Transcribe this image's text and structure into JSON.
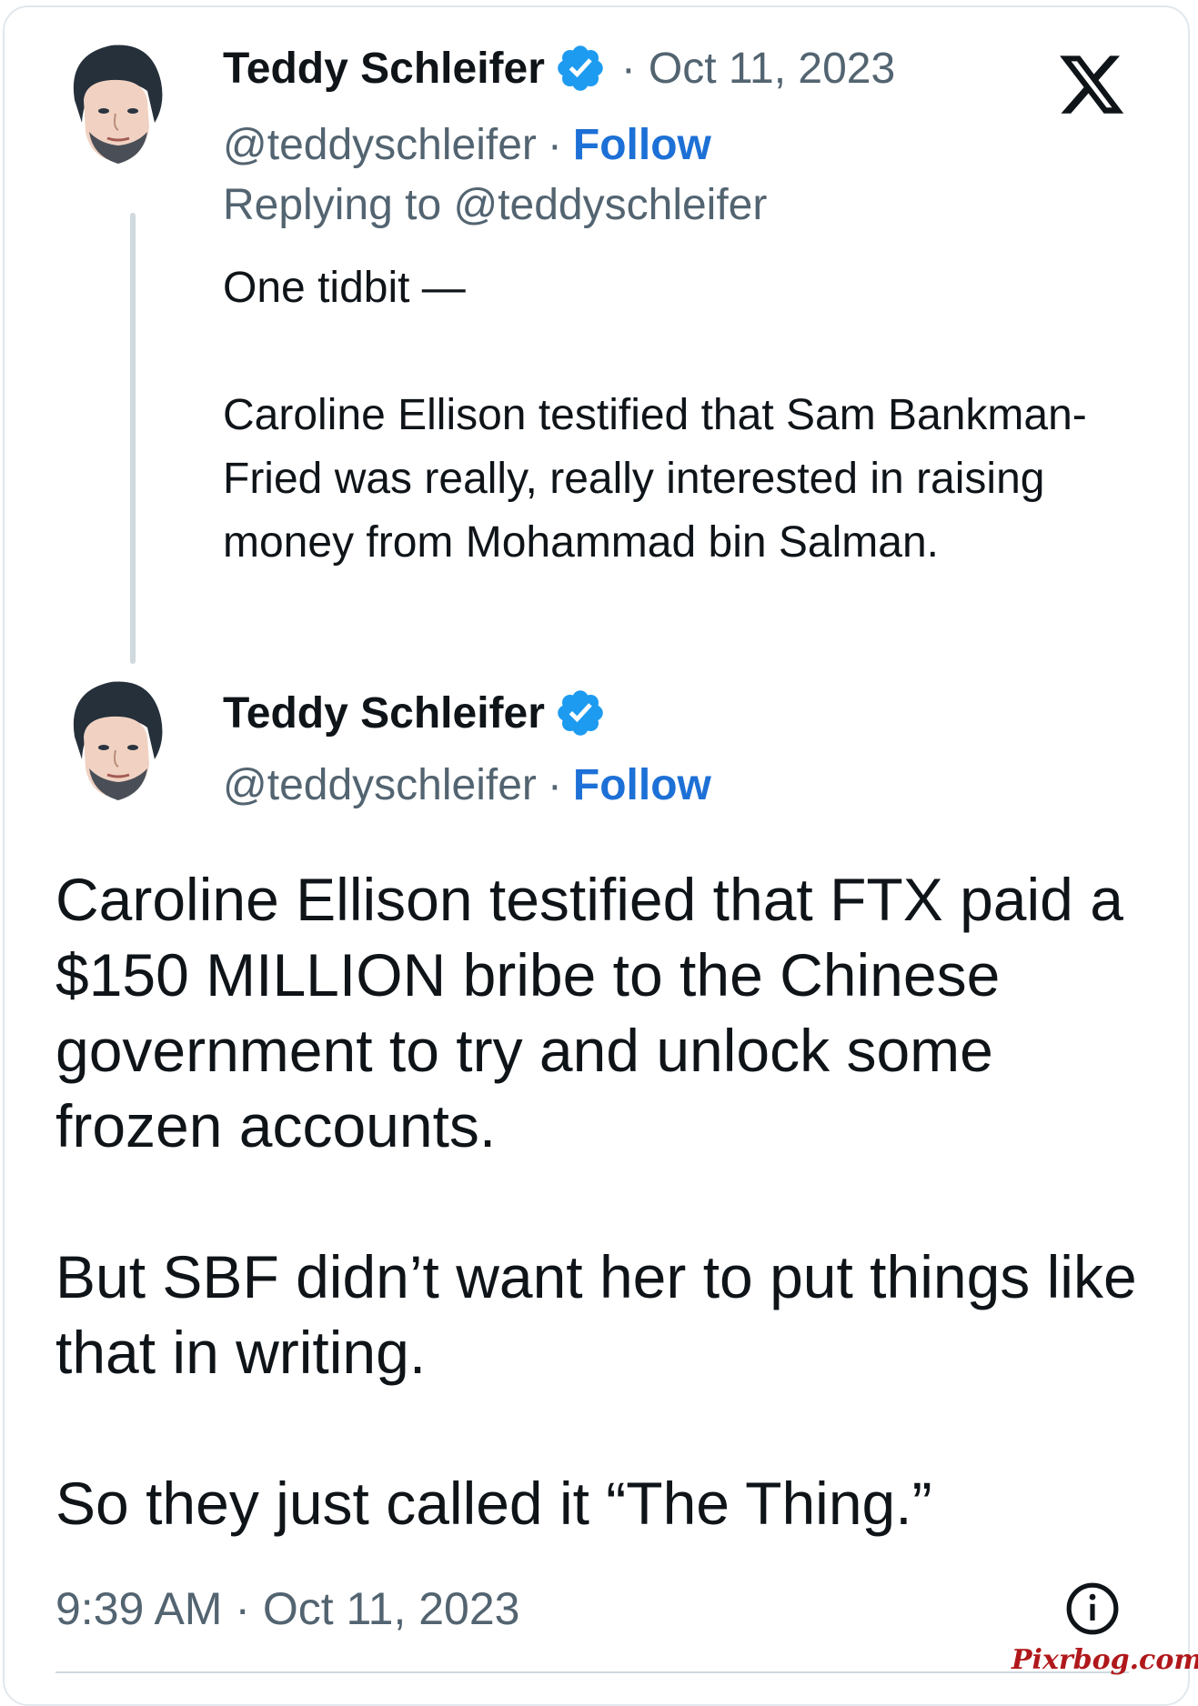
{
  "reply_tweet": {
    "author_name": "Teddy Schleifer",
    "handle": "@teddyschleifer",
    "date": "Oct 11, 2023",
    "date_separator": "·",
    "follow_label": "Follow",
    "handle_separator": "·",
    "replying_to": "Replying to @teddyschleifer",
    "text_paragraphs": [
      "One tidbit —",
      "Caroline Ellison testified that Sam Bankman-Fried was really, really interested in raising money from Mohammad bin Salman."
    ]
  },
  "main_tweet": {
    "author_name": "Teddy Schleifer",
    "handle": "@teddyschleifer",
    "follow_label": "Follow",
    "handle_separator": "·",
    "text_paragraphs": [
      "Caroline Ellison testified that FTX paid a $150 MILLION bribe to the Chinese government to try and unlock some frozen accounts.",
      "But SBF didn’t want her to put things like that in writing.",
      "So they just called it “The Thing.”"
    ],
    "timestamp": "9:39 AM · Oct 11, 2023"
  },
  "watermark": "Pixrbog.com",
  "icons": {
    "platform_logo": "x-logo-icon",
    "verified": "verified-badge-icon",
    "info": "info-icon"
  },
  "colors": {
    "follow_link": "#1d70d6",
    "verified_badge": "#1d9bf0",
    "secondary_text": "#536471",
    "watermark": "#b0181b"
  }
}
